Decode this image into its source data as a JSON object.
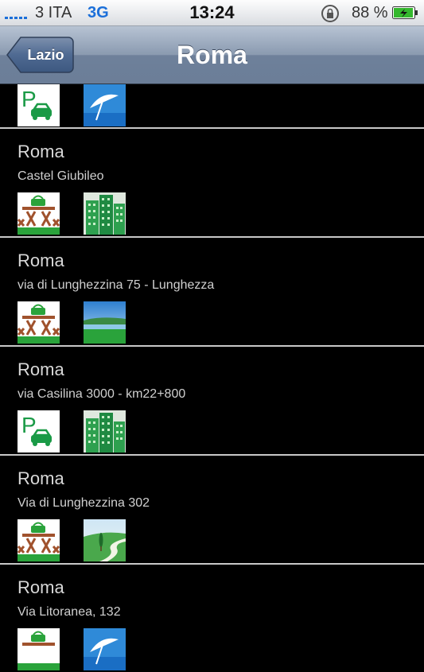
{
  "status_bar": {
    "carrier": "3 ITA",
    "network": "3G",
    "time": "13:24",
    "battery": "88 %"
  },
  "nav": {
    "back_label": "Lazio",
    "title": "Roma"
  },
  "list": [
    {
      "icons": [
        "parking-icon",
        "beach-icon"
      ]
    },
    {
      "name": "Roma",
      "address": "Castel Giubileo",
      "icons": [
        "picnic-area-icon",
        "buildings-icon"
      ]
    },
    {
      "name": "Roma",
      "address": "via di Lunghezzina 75 - Lunghezza",
      "icons": [
        "picnic-area-icon",
        "lake-landscape-icon"
      ]
    },
    {
      "name": "Roma",
      "address": "via Casilina 3000 - km22+800",
      "icons": [
        "parking-icon",
        "buildings-icon"
      ]
    },
    {
      "name": "Roma",
      "address": "Via di Lunghezzina 302",
      "icons": [
        "picnic-area-icon",
        "countryside-icon"
      ]
    },
    {
      "name": "Roma",
      "address": "Via Litoranea, 132",
      "icons": [
        "picnic-area-icon",
        "beach-icon"
      ]
    }
  ],
  "colors": {
    "accent": "#1b6fd9",
    "nav": "#6b7e98",
    "list_bg": "#000000",
    "text": "#d8d8d8"
  }
}
